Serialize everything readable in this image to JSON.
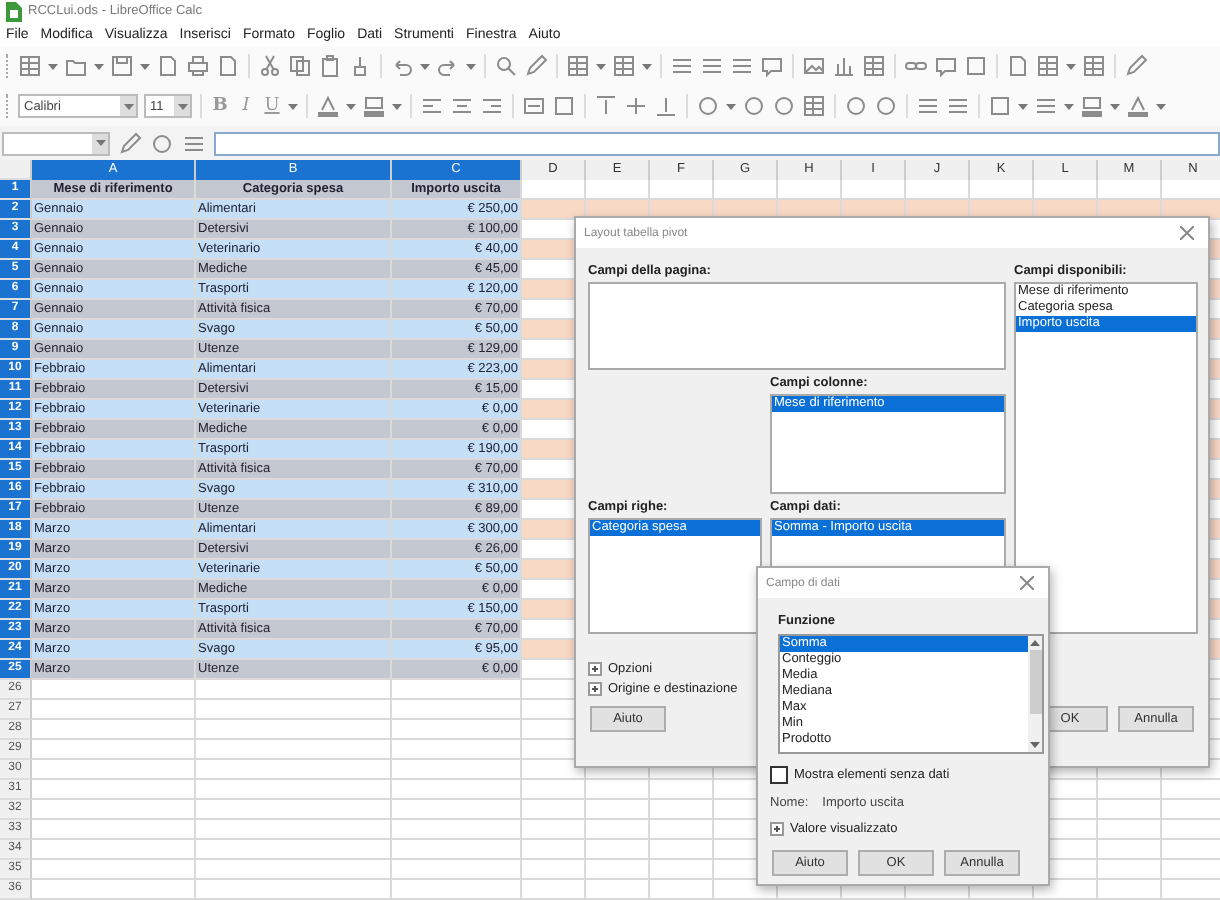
{
  "window": {
    "title": "RCCLui.ods - LibreOffice Calc"
  },
  "menu": [
    "File",
    "Modifica",
    "Visualizza",
    "Inserisci",
    "Formato",
    "Foglio",
    "Dati",
    "Strumenti",
    "Finestra",
    "Aiuto"
  ],
  "font_name": {
    "value": "Calibri"
  },
  "font_size": {
    "value": "11"
  },
  "format_buttons": [
    "B",
    "I",
    "U"
  ],
  "sheet": {
    "columns": [
      {
        "label": "A",
        "selected": true
      },
      {
        "label": "B",
        "selected": true
      },
      {
        "label": "C",
        "selected": true
      },
      {
        "label": "D",
        "selected": false
      },
      {
        "label": "E",
        "selected": false
      },
      {
        "label": "F",
        "selected": false
      },
      {
        "label": "G",
        "selected": false
      },
      {
        "label": "H",
        "selected": false
      },
      {
        "label": "I",
        "selected": false
      },
      {
        "label": "J",
        "selected": false
      },
      {
        "label": "K",
        "selected": false
      },
      {
        "label": "L",
        "selected": false
      },
      {
        "label": "M",
        "selected": false
      },
      {
        "label": "N",
        "selected": false
      }
    ],
    "rows": [
      {
        "number": "1",
        "selected": true,
        "kind": "header",
        "cells": [
          "Mese di riferimento",
          "Categoria spesa",
          "Importo uscita"
        ]
      },
      {
        "number": "2",
        "selected": true,
        "kind": "data",
        "cells": [
          "Gennaio",
          "Alimentari",
          "€ 250,00"
        ]
      },
      {
        "number": "3",
        "selected": true,
        "kind": "data",
        "cells": [
          "Gennaio",
          "Detersivi",
          "€ 100,00"
        ]
      },
      {
        "number": "4",
        "selected": true,
        "kind": "data",
        "cells": [
          "Gennaio",
          "Veterinario",
          "€ 40,00"
        ]
      },
      {
        "number": "5",
        "selected": true,
        "kind": "data",
        "cells": [
          "Gennaio",
          "Mediche",
          "€ 45,00"
        ]
      },
      {
        "number": "6",
        "selected": true,
        "kind": "data",
        "cells": [
          "Gennaio",
          "Trasporti",
          "€ 120,00"
        ]
      },
      {
        "number": "7",
        "selected": true,
        "kind": "data",
        "cells": [
          "Gennaio",
          "Attività fisica",
          "€ 70,00"
        ]
      },
      {
        "number": "8",
        "selected": true,
        "kind": "data",
        "cells": [
          "Gennaio",
          "Svago",
          "€ 50,00"
        ]
      },
      {
        "number": "9",
        "selected": true,
        "kind": "data",
        "cells": [
          "Gennaio",
          "Utenze",
          "€ 129,00"
        ]
      },
      {
        "number": "10",
        "selected": true,
        "kind": "data",
        "cells": [
          "Febbraio",
          "Alimentari",
          "€ 223,00"
        ]
      },
      {
        "number": "11",
        "selected": true,
        "kind": "data",
        "cells": [
          "Febbraio",
          "Detersivi",
          "€ 15,00"
        ]
      },
      {
        "number": "12",
        "selected": true,
        "kind": "data",
        "cells": [
          "Febbraio",
          "Veterinarie",
          "€ 0,00"
        ]
      },
      {
        "number": "13",
        "selected": true,
        "kind": "data",
        "cells": [
          "Febbraio",
          "Mediche",
          "€ 0,00"
        ]
      },
      {
        "number": "14",
        "selected": true,
        "kind": "data",
        "cells": [
          "Febbraio",
          "Trasporti",
          "€ 190,00"
        ]
      },
      {
        "number": "15",
        "selected": true,
        "kind": "data",
        "cells": [
          "Febbraio",
          "Attività fisica",
          "€ 70,00"
        ]
      },
      {
        "number": "16",
        "selected": true,
        "kind": "data",
        "cells": [
          "Febbraio",
          "Svago",
          "€ 310,00"
        ]
      },
      {
        "number": "17",
        "selected": true,
        "kind": "data",
        "cells": [
          "Febbraio",
          "Utenze",
          "€ 89,00"
        ]
      },
      {
        "number": "18",
        "selected": true,
        "kind": "data",
        "cells": [
          "Marzo",
          "Alimentari",
          "€ 300,00"
        ]
      },
      {
        "number": "19",
        "selected": true,
        "kind": "data",
        "cells": [
          "Marzo",
          "Detersivi",
          "€ 26,00"
        ]
      },
      {
        "number": "20",
        "selected": true,
        "kind": "data",
        "cells": [
          "Marzo",
          "Veterinarie",
          "€ 50,00"
        ]
      },
      {
        "number": "21",
        "selected": true,
        "kind": "data",
        "cells": [
          "Marzo",
          "Mediche",
          "€ 0,00"
        ]
      },
      {
        "number": "22",
        "selected": true,
        "kind": "data",
        "cells": [
          "Marzo",
          "Trasporti",
          "€ 150,00"
        ]
      },
      {
        "number": "23",
        "selected": true,
        "kind": "data",
        "cells": [
          "Marzo",
          "Attività fisica",
          "€ 70,00"
        ]
      },
      {
        "number": "24",
        "selected": true,
        "kind": "data",
        "cells": [
          "Marzo",
          "Svago",
          "€ 95,00"
        ]
      },
      {
        "number": "25",
        "selected": true,
        "kind": "data",
        "cells": [
          "Marzo",
          "Utenze",
          "€ 0,00"
        ]
      },
      {
        "number": "26",
        "selected": false,
        "kind": "empty"
      },
      {
        "number": "27",
        "selected": false,
        "kind": "empty"
      },
      {
        "number": "28",
        "selected": false,
        "kind": "empty"
      },
      {
        "number": "29",
        "selected": false,
        "kind": "empty"
      },
      {
        "number": "30",
        "selected": false,
        "kind": "empty"
      },
      {
        "number": "31",
        "selected": false,
        "kind": "empty"
      },
      {
        "number": "32",
        "selected": false,
        "kind": "empty"
      },
      {
        "number": "33",
        "selected": false,
        "kind": "empty"
      },
      {
        "number": "34",
        "selected": false,
        "kind": "empty"
      },
      {
        "number": "35",
        "selected": false,
        "kind": "empty"
      },
      {
        "number": "36",
        "selected": false,
        "kind": "empty"
      }
    ]
  },
  "pivot_dialog": {
    "title": "Layout tabella pivot",
    "page_fields": {
      "label": "Campi della pagina:"
    },
    "available_fields": {
      "label": "Campi disponibili:",
      "items": [
        {
          "text": "Mese di riferimento",
          "selected": false
        },
        {
          "text": "Categoria spesa",
          "selected": false
        },
        {
          "text": "Importo uscita",
          "selected": true
        }
      ]
    },
    "column_fields": {
      "label": "Campi colonne:",
      "items": [
        {
          "text": "Mese di riferimento",
          "selected": true
        }
      ]
    },
    "row_fields": {
      "label": "Campi righe:",
      "items": [
        {
          "text": "Categoria spesa",
          "selected": true
        }
      ]
    },
    "data_fields": {
      "label": "Campi dati:",
      "items": [
        {
          "text": "Somma - Importo uscita",
          "selected": true
        }
      ]
    },
    "expanders": [
      {
        "label": "Opzioni",
        "expanded": false
      },
      {
        "label": "Origine e destinazione",
        "expanded": false
      }
    ],
    "buttons": [
      "Aiuto",
      "OK",
      "Annulla"
    ]
  },
  "field_dialog": {
    "title": "Campo di dati",
    "function_label": "Funzione",
    "functions": [
      {
        "text": "Somma",
        "selected": true
      },
      {
        "text": "Conteggio",
        "selected": false
      },
      {
        "text": "Media",
        "selected": false
      },
      {
        "text": "Mediana",
        "selected": false
      },
      {
        "text": "Max",
        "selected": false
      },
      {
        "text": "Min",
        "selected": false
      },
      {
        "text": "Prodotto",
        "selected": false
      }
    ],
    "show_empty": {
      "label": "Mostra elementi senza dati",
      "checked": false
    },
    "name_label": "Nome:",
    "name_value": "Importo uscita",
    "expander": {
      "label": "Valore visualizzato",
      "expanded": false
    },
    "buttons": [
      "Aiuto",
      "OK",
      "Annulla"
    ]
  }
}
